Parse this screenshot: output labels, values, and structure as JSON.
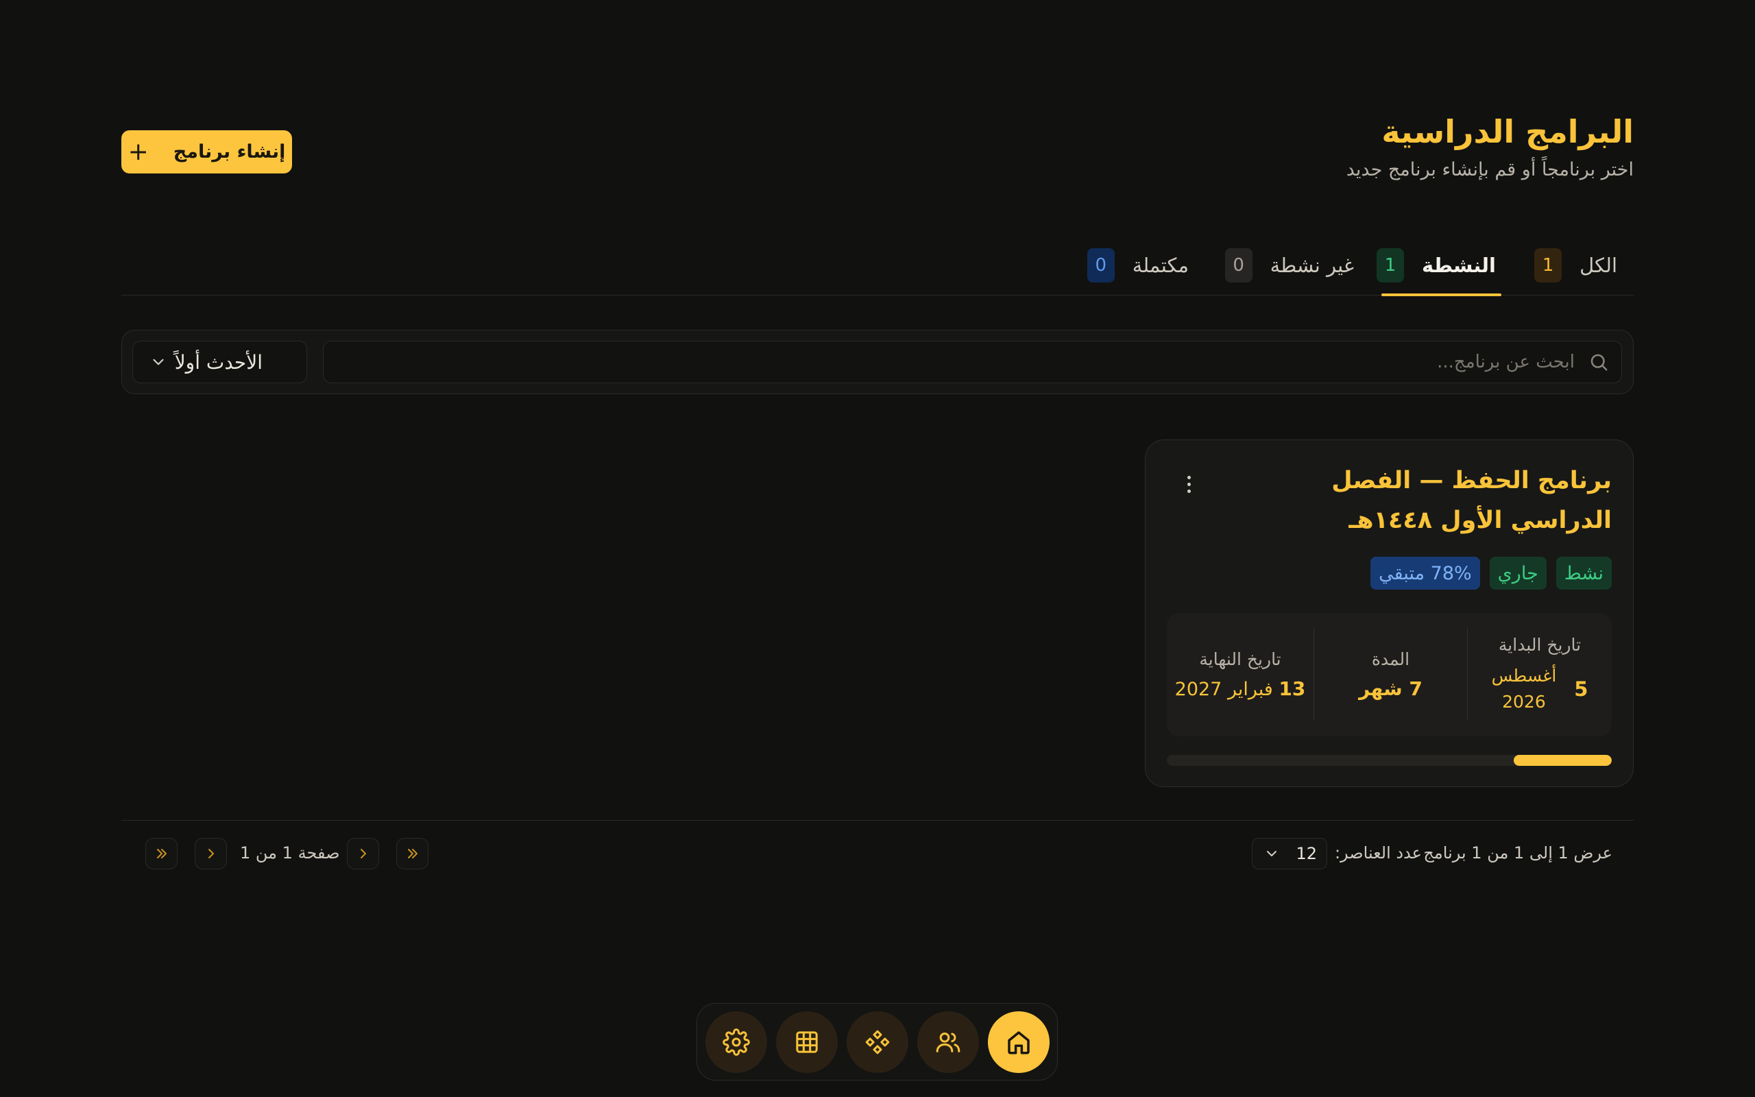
{
  "header": {
    "title": "البرامج الدراسية",
    "subtitle": "اختر برنامجاً أو قم بإنشاء برنامج جديد",
    "create_button_label": "إنشاء برنامج"
  },
  "tabs": [
    {
      "label": "الكل",
      "count": "1"
    },
    {
      "label": "النشطة",
      "count": "1",
      "active": true
    },
    {
      "label": "غير نشطة",
      "count": "0"
    },
    {
      "label": "مكتملة",
      "count": "0"
    }
  ],
  "filters": {
    "search_placeholder": "ابحث عن برنامج...",
    "sort_value": "الأحدث أولاً"
  },
  "program_card": {
    "title": "برنامج الحفظ — الفصل الدراسي الأول ١٤٤٨هـ",
    "badges": [
      "نشط",
      "جاري",
      "78% متبقي"
    ],
    "start_label": "تاريخ البداية",
    "start_day": "5",
    "start_month": "أغسطس",
    "start_year": "2026",
    "duration_label": "المدة",
    "duration_value": "7 شهر",
    "end_label": "تاريخ النهاية",
    "end_day": "13",
    "end_month_year": "فبراير 2027",
    "progress_percent": 22
  },
  "pagination": {
    "results_text": "عرض 1 إلى 1 من 1 برنامج",
    "per_page_label": "عدد العناصر:",
    "per_page_value": "12",
    "page_info": "صفحة 1 من 1"
  },
  "dock": {
    "items": [
      "home-icon",
      "users-icon",
      "diamonds-icon",
      "table-grid-icon",
      "settings-gear-icon"
    ],
    "active": "home-icon"
  },
  "colors": {
    "accent": "#f9c33a",
    "background": "#111110",
    "card": "#181816"
  }
}
